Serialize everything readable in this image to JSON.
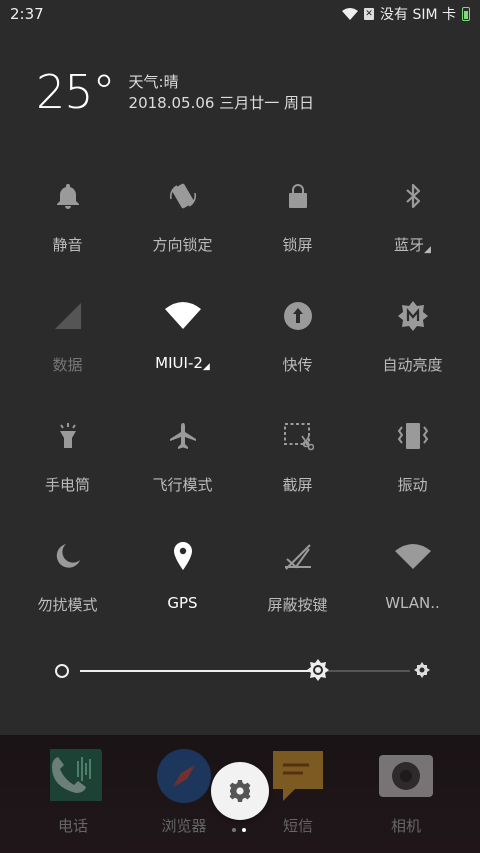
{
  "status": {
    "time": "2:37",
    "carrier": "没有 SIM 卡",
    "sim_icon_text": "✕"
  },
  "header": {
    "temperature": "25°",
    "weather": "天气:晴",
    "date": "2018.05.06 三月廿一 周日"
  },
  "tiles": [
    {
      "label": "静音",
      "icon": "bell-icon",
      "state": "off"
    },
    {
      "label": "方向锁定",
      "icon": "rotation-lock-icon",
      "state": "off"
    },
    {
      "label": "锁屏",
      "icon": "lock-icon",
      "state": "off"
    },
    {
      "label": "蓝牙",
      "icon": "bluetooth-icon",
      "state": "off",
      "has_menu": true
    },
    {
      "label": "数据",
      "icon": "mobile-data-icon",
      "state": "disabled"
    },
    {
      "label": "MIUI-2",
      "icon": "wifi-icon",
      "state": "on",
      "has_menu": true
    },
    {
      "label": "快传",
      "icon": "quick-transfer-icon",
      "state": "off"
    },
    {
      "label": "自动亮度",
      "icon": "auto-brightness-icon",
      "state": "off"
    },
    {
      "label": "手电筒",
      "icon": "flashlight-icon",
      "state": "off"
    },
    {
      "label": "飞行模式",
      "icon": "airplane-icon",
      "state": "off"
    },
    {
      "label": "截屏",
      "icon": "screenshot-icon",
      "state": "off"
    },
    {
      "label": "振动",
      "icon": "vibrate-icon",
      "state": "off"
    },
    {
      "label": "勿扰模式",
      "icon": "moon-icon",
      "state": "off"
    },
    {
      "label": "GPS",
      "icon": "location-pin-icon",
      "state": "on"
    },
    {
      "label": "屏蔽按键",
      "icon": "block-keys-icon",
      "state": "off"
    },
    {
      "label": "WLAN..",
      "icon": "wlan-hotspot-icon",
      "state": "off"
    }
  ],
  "brightness": {
    "level": 0.72
  },
  "dock": {
    "apps": [
      "电话",
      "浏览器",
      "短信",
      "相机"
    ]
  },
  "colors": {
    "background": "#2b2b2b",
    "icon_off": "#9a9a9a",
    "icon_on": "#ffffff",
    "battery": "#7ddc7a"
  }
}
